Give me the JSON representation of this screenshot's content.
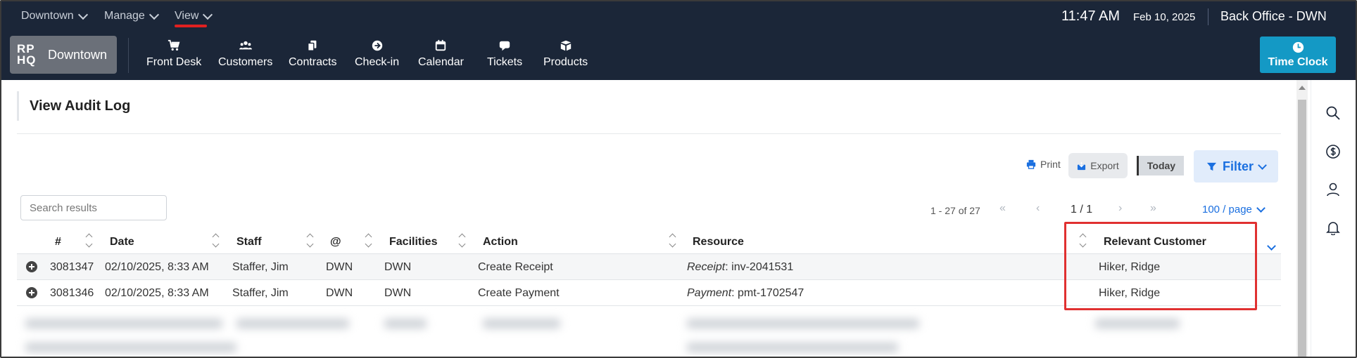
{
  "topbar": {
    "menus": [
      {
        "label": "Downtown"
      },
      {
        "label": "Manage"
      },
      {
        "label": "View"
      }
    ],
    "time": "11:47 AM",
    "date": "Feb 10, 2025",
    "office": "Back Office - DWN",
    "active_menu_color": "#e02020"
  },
  "nav": {
    "brand_logo": "RP HQ",
    "brand_name": "Downtown",
    "items": [
      {
        "label": "Front Desk",
        "icon": "cart-icon"
      },
      {
        "label": "Customers",
        "icon": "users-icon"
      },
      {
        "label": "Contracts",
        "icon": "contracts-icon"
      },
      {
        "label": "Check-in",
        "icon": "arrow-circle-icon"
      },
      {
        "label": "Calendar",
        "icon": "calendar-icon"
      },
      {
        "label": "Tickets",
        "icon": "chat-icon"
      },
      {
        "label": "Products",
        "icon": "box-icon"
      }
    ],
    "time_clock": "Time Clock",
    "time_clock_color": "#1499c5"
  },
  "page": {
    "title": "View Audit Log"
  },
  "toolbar": {
    "print": "Print",
    "export": "Export",
    "today": "Today",
    "filter": "Filter"
  },
  "search": {
    "placeholder": "Search results",
    "value": ""
  },
  "pagination": {
    "range": "1 - 27 of 27",
    "page": "1 / 1",
    "per_page": "100 / page"
  },
  "table": {
    "headers": [
      "#",
      "Date",
      "Staff",
      "@",
      "Facilities",
      "Action",
      "Resource",
      "Relevant Customer"
    ],
    "rows": [
      {
        "id": "3081347",
        "date": "02/10/2025, 8:33 AM",
        "staff": "Staffer, Jim",
        "at": "DWN",
        "facilities": "DWN",
        "action": "Create Receipt",
        "resource_type": "Receipt",
        "resource_value": ": inv-2041531",
        "customer": "Hiker, Ridge"
      },
      {
        "id": "3081346",
        "date": "02/10/2025, 8:33 AM",
        "staff": "Staffer, Jim",
        "at": "DWN",
        "facilities": "DWN",
        "action": "Create Payment",
        "resource_type": "Payment",
        "resource_value": ": pmt-1702547",
        "customer": "Hiker, Ridge"
      }
    ]
  },
  "rail": {
    "icons": [
      "search-icon",
      "dollar-icon",
      "user-icon",
      "bell-icon"
    ]
  },
  "colors": {
    "header_bg": "#1b2638",
    "accent": "#1a6fe0",
    "highlight": "#e03030"
  }
}
